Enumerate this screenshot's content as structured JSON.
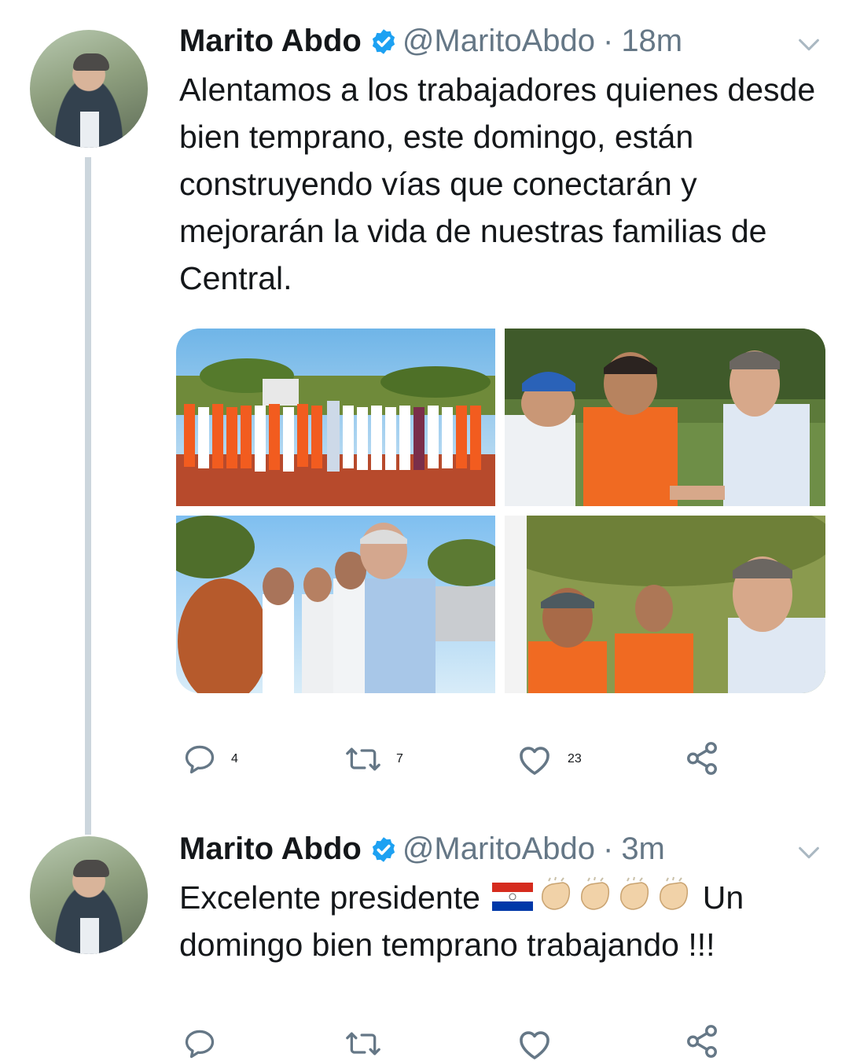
{
  "tweets": [
    {
      "author_name": "Marito Abdo",
      "handle": "@MaritoAbdo",
      "separator": "·",
      "time": "18m",
      "text": "Alentamos a los trabajadores quienes desde bien temprano, este domingo, están construyendo vías que conectarán y mejorarán la vida de nuestras familias de Central.",
      "replies": "4",
      "retweets": "7",
      "likes": "23"
    },
    {
      "author_name": "Marito Abdo",
      "handle": "@MaritoAbdo",
      "separator": "·",
      "time": "3m",
      "text_before_emoji": "Excelente presidente",
      "text_after_emoji": "Un domingo bien temprano trabajando !!!"
    }
  ],
  "colors": {
    "verified_blue": "#1da1f2",
    "secondary_text": "#657786",
    "thread_line": "#ccd6dd",
    "worker_orange": "#f25c1f"
  },
  "icons": [
    "verified-badge-icon",
    "chevron-down-icon",
    "reply-icon",
    "retweet-icon",
    "like-icon",
    "share-icon",
    "paraguay-flag-emoji",
    "clapping-hands-emoji"
  ]
}
